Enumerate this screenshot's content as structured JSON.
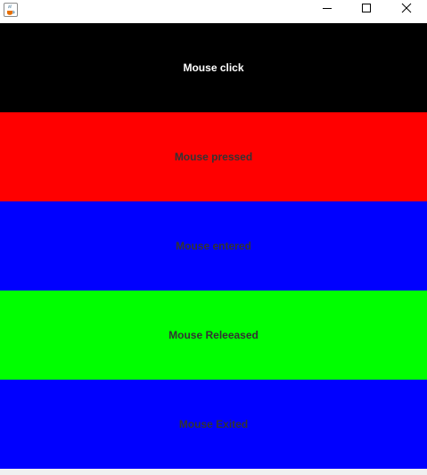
{
  "window": {
    "controls": {
      "minimize": "minimize-icon",
      "maximize": "maximize-icon",
      "close": "close-icon"
    },
    "app_icon": "java-cup-icon"
  },
  "panels": [
    {
      "label": "Mouse click",
      "background": "#000000",
      "text_color": "#ffffff"
    },
    {
      "label": "Mouse pressed",
      "background": "#ff0000",
      "text_color": "#333333"
    },
    {
      "label": "Mouse entered",
      "background": "#0000ff",
      "text_color": "#333333"
    },
    {
      "label": "Mouse Releeased",
      "background": "#00ff00",
      "text_color": "#333333"
    },
    {
      "label": "Mouse Exited",
      "background": "#0000ff",
      "text_color": "#333333"
    }
  ]
}
